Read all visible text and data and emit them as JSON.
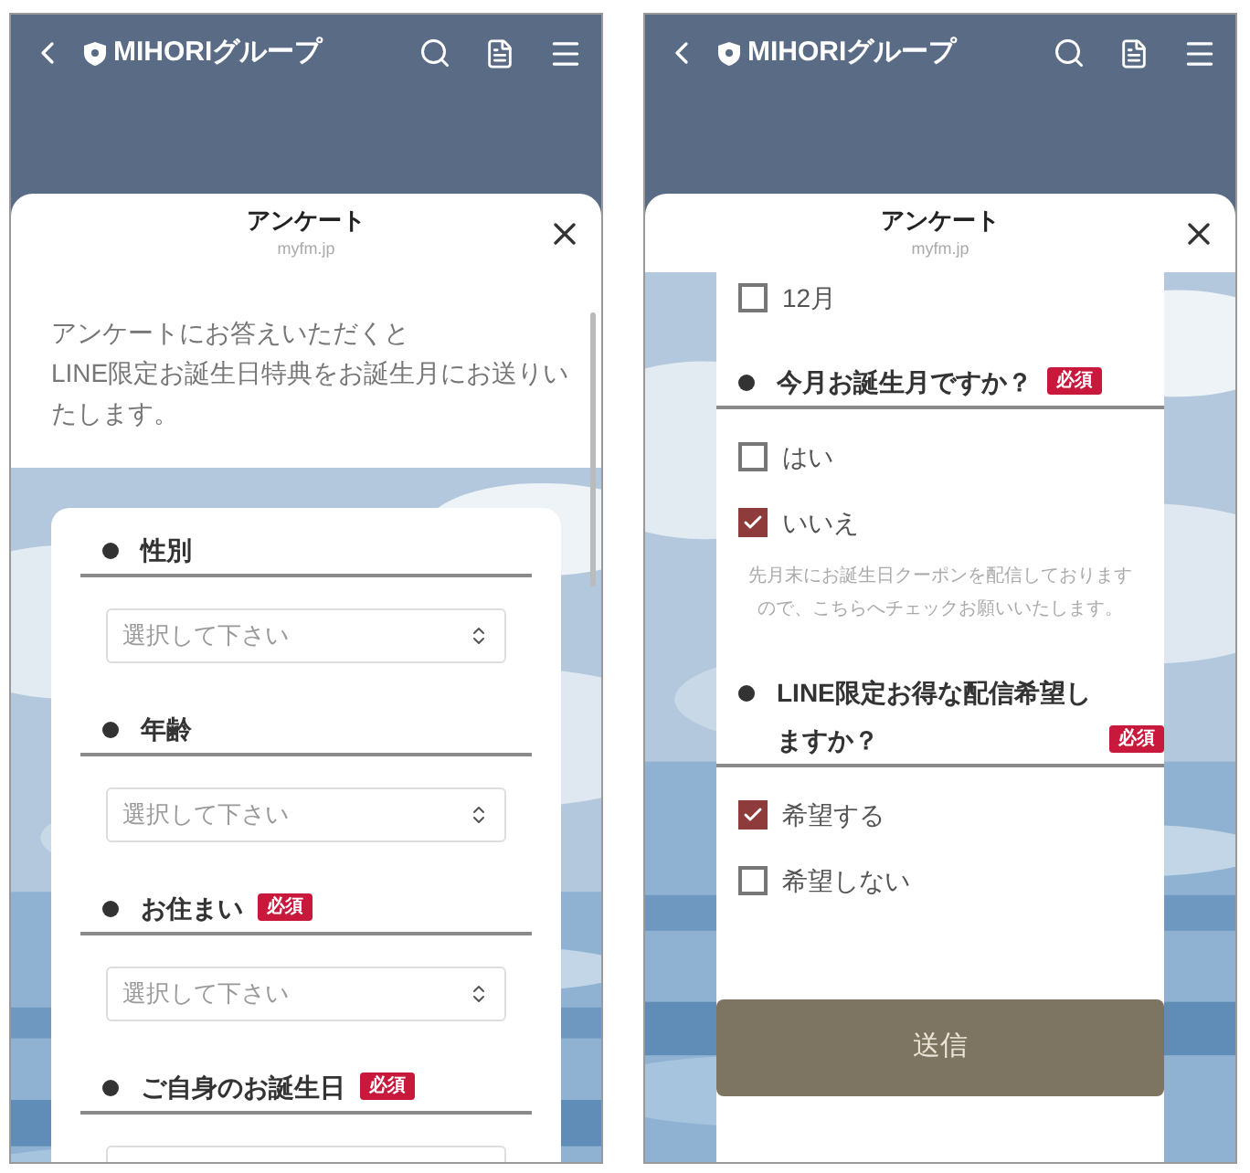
{
  "phones": [
    {
      "header": {
        "title": "MIHORIグループ"
      },
      "sheet": {
        "title": "アンケート",
        "domain": "myfm.jp"
      },
      "intro": "アンケートにお答えいただくと\nLINE限定お誕生日特典をお誕生月にお送りいたします。",
      "blocks": [
        {
          "kind": "question",
          "label": "性別"
        },
        {
          "kind": "select",
          "placeholder": "選択して下さい"
        },
        {
          "kind": "question",
          "label": "年齢"
        },
        {
          "kind": "select",
          "placeholder": "選択して下さい"
        },
        {
          "kind": "question",
          "label": "お住まい",
          "badge": "必須"
        },
        {
          "kind": "select",
          "placeholder": "選択して下さい"
        },
        {
          "kind": "question",
          "label": "ご自身のお誕生日",
          "badge": "必須"
        },
        {
          "kind": "select"
        }
      ]
    },
    {
      "header": {
        "title": "MIHORIグループ"
      },
      "sheet": {
        "title": "アンケート",
        "domain": "myfm.jp"
      },
      "blocks": [
        {
          "kind": "checkbox",
          "label": "12月",
          "checked": false
        },
        {
          "kind": "question",
          "label": "今月お誕生月ですか？",
          "badge": "必須"
        },
        {
          "kind": "checkbox",
          "label": "はい",
          "checked": false
        },
        {
          "kind": "checkbox",
          "label": "いいえ",
          "checked": true
        },
        {
          "kind": "note",
          "text": "先月末にお誕生日クーポンを配信しておりますので、こちらへチェックお願いいたします。"
        },
        {
          "kind": "question",
          "label": "LINE限定お得な配信希望しますか？",
          "badge": "必須"
        },
        {
          "kind": "checkbox",
          "label": "希望する",
          "checked": true
        },
        {
          "kind": "checkbox",
          "label": "希望しない",
          "checked": false
        },
        {
          "kind": "button",
          "label": "送信"
        }
      ]
    }
  ]
}
